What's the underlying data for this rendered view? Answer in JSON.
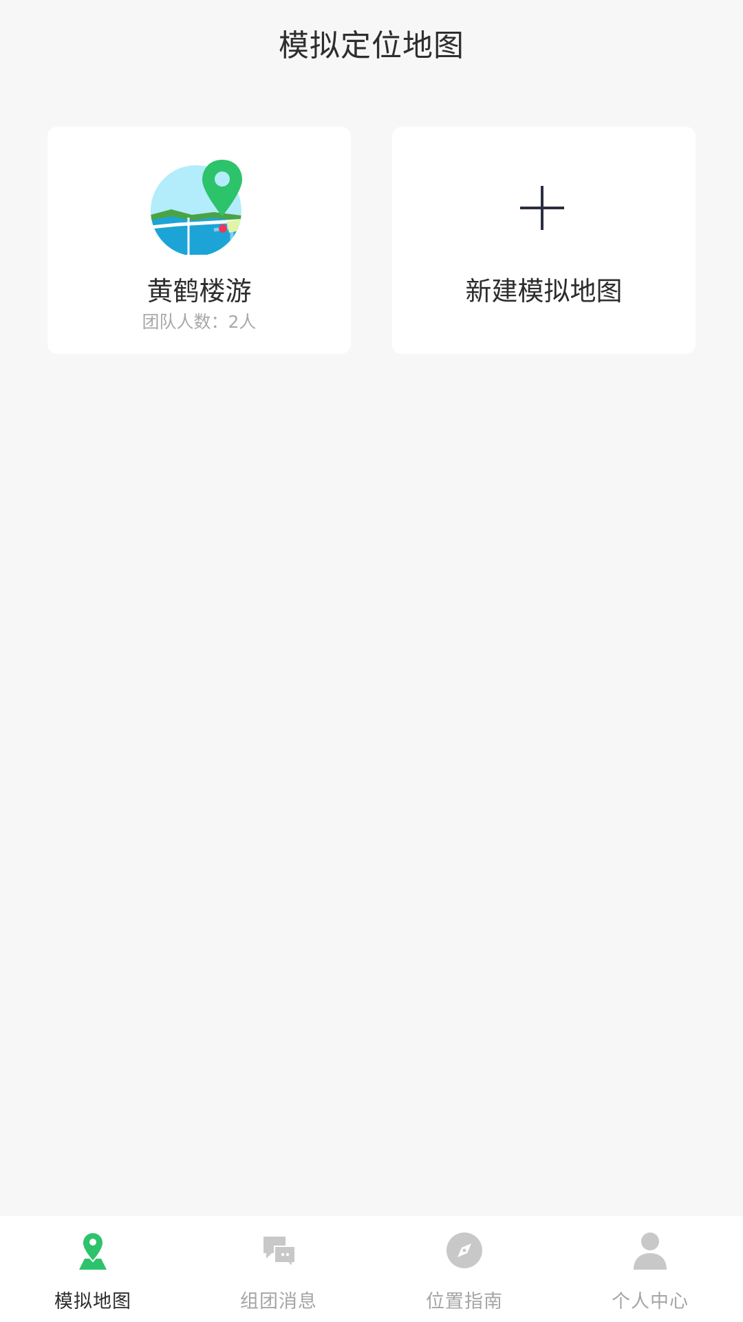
{
  "header": {
    "title": "模拟定位地图"
  },
  "cards": {
    "map": {
      "name": "黄鹤楼游",
      "team_count": "团队人数：2人",
      "icon": "map-pin-globe-icon"
    },
    "new": {
      "label": "新建模拟地图",
      "icon": "plus-icon"
    }
  },
  "tabbar": {
    "tabs": [
      {
        "label": "模拟地图",
        "icon": "map-pin-icon",
        "active": true
      },
      {
        "label": "组团消息",
        "icon": "chat-icon",
        "active": false
      },
      {
        "label": "位置指南",
        "icon": "compass-icon",
        "active": false
      },
      {
        "label": "个人中心",
        "icon": "user-icon",
        "active": false
      }
    ]
  },
  "colors": {
    "background": "#f7f7f7",
    "accent": "#2cc36b",
    "inactive": "#c8c8c8",
    "text": "#2d2d2d"
  }
}
